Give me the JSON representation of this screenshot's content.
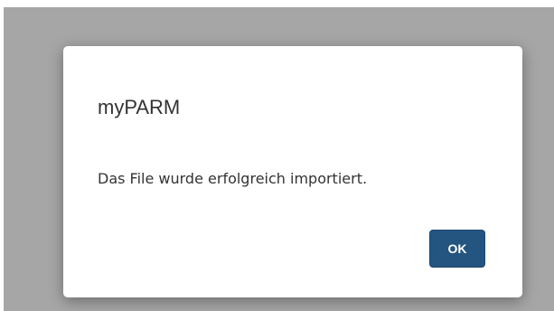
{
  "dialog": {
    "title": "myPARM",
    "message": "Das File wurde erfolgreich importiert.",
    "ok_label": "OK"
  },
  "colors": {
    "backdrop": "#a6a6a6",
    "primary_button": "#245580",
    "text": "#333333"
  }
}
